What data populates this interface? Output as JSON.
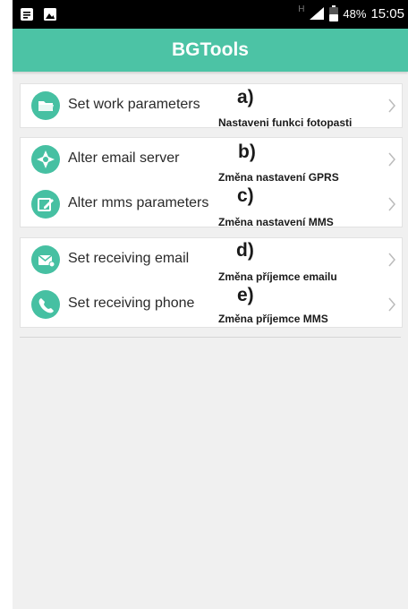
{
  "status_bar": {
    "network_indicator": "H",
    "battery_percent": "48%",
    "time": "15:05",
    "left_icons": [
      "notes-icon",
      "image-icon"
    ],
    "right_icons": [
      "signal-icon",
      "battery-icon"
    ]
  },
  "app_bar": {
    "title": "BGTools"
  },
  "menu": {
    "items": [
      {
        "label": "Set work parameters",
        "icon": "folder-icon",
        "annotation_letter": "a)",
        "annotation_text": "Nastaveni funkci fotopasti"
      },
      {
        "label": "Alter email server",
        "icon": "compass-icon",
        "annotation_letter": "b)",
        "annotation_text": "Změna nastavení GPRS"
      },
      {
        "label": "Alter mms parameters",
        "icon": "edit-icon",
        "annotation_letter": "c)",
        "annotation_text": "Změna nastavení MMS"
      },
      {
        "label": "Set receiving email",
        "icon": "mail-icon",
        "annotation_letter": "d)",
        "annotation_text": "Změna příjemce emailu"
      },
      {
        "label": "Set receiving phone",
        "icon": "phone-icon",
        "annotation_letter": "e)",
        "annotation_text": "Změna příjemce MMS"
      }
    ]
  },
  "colors": {
    "accent": "#4cc3a5",
    "icon_bg": "#46c0a2",
    "background": "#f0f0f0",
    "status_bar": "#000000"
  }
}
